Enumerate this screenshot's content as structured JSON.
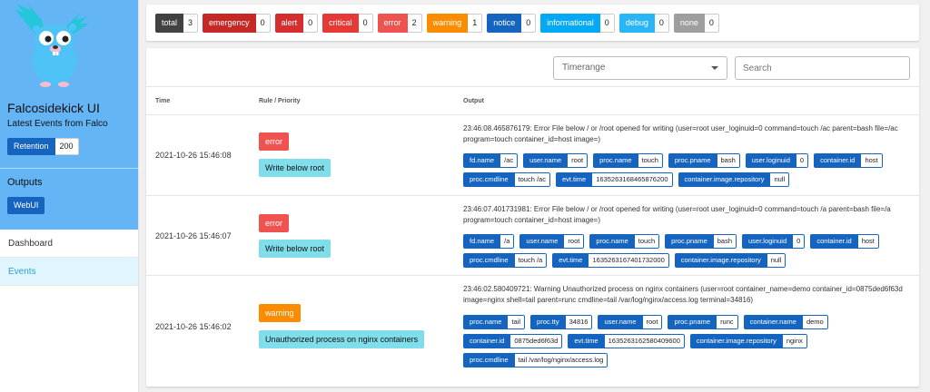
{
  "sidebar": {
    "title": "Falcosidekick UI",
    "subtitle": "Latest Events from Falco",
    "retention_label": "Retention",
    "retention_value": "200",
    "outputs_title": "Outputs",
    "outputs_button": "WebUI",
    "nav": [
      {
        "label": "Dashboard",
        "active": false
      },
      {
        "label": "Events",
        "active": true
      }
    ],
    "colors": {
      "top_bg": "#64b5f6",
      "active_bg": "#e1f5fe"
    }
  },
  "filters": [
    {
      "name": "total",
      "count": "3",
      "color": "#424242"
    },
    {
      "name": "emergency",
      "count": "0",
      "color": "#c62828"
    },
    {
      "name": "alert",
      "count": "0",
      "color": "#d32f2f"
    },
    {
      "name": "critical",
      "count": "0",
      "color": "#e53935"
    },
    {
      "name": "error",
      "count": "2",
      "color": "#ef5350"
    },
    {
      "name": "warning",
      "count": "1",
      "color": "#fb8c00"
    },
    {
      "name": "notice",
      "count": "0",
      "color": "#1565c0"
    },
    {
      "name": "informational",
      "count": "0",
      "color": "#03a9f4"
    },
    {
      "name": "debug",
      "count": "0",
      "color": "#29b6f6"
    },
    {
      "name": "none",
      "count": "0",
      "color": "#9e9e9e"
    }
  ],
  "toolbar": {
    "timerange_placeholder": "Timerange",
    "search_placeholder": "Search"
  },
  "table": {
    "headers": {
      "time": "Time",
      "rule": "Rule / Priority",
      "output": "Output"
    },
    "rows": [
      {
        "time": "2021-10-26 15:46:08",
        "priority": "error",
        "priority_color": "#ef5350",
        "rule": "Write below root",
        "output": "23:46:08.465876179: Error File below / or /root opened for writing (user=root user_loginuid=0 command=touch /ac parent=bash file=/ac program=touch container_id=host image=)",
        "fields": [
          {
            "k": "fd.name",
            "v": "/ac"
          },
          {
            "k": "user.name",
            "v": "root"
          },
          {
            "k": "proc.name",
            "v": "touch"
          },
          {
            "k": "proc.pname",
            "v": "bash"
          },
          {
            "k": "user.loginuid",
            "v": "0"
          },
          {
            "k": "container.id",
            "v": "host"
          },
          {
            "k": "proc.cmdline",
            "v": "touch /ac"
          },
          {
            "k": "evt.time",
            "v": "1635263168465876200"
          },
          {
            "k": "container.image.repository",
            "v": "null"
          }
        ]
      },
      {
        "time": "2021-10-26 15:46:07",
        "priority": "error",
        "priority_color": "#ef5350",
        "rule": "Write below root",
        "output": "23:46:07.401731981: Error File below / or /root opened for writing (user=root user_loginuid=0 command=touch /a parent=bash file=/a program=touch container_id=host image=)",
        "fields": [
          {
            "k": "fd.name",
            "v": "/a"
          },
          {
            "k": "user.name",
            "v": "root"
          },
          {
            "k": "proc.name",
            "v": "touch"
          },
          {
            "k": "proc.pname",
            "v": "bash"
          },
          {
            "k": "user.loginuid",
            "v": "0"
          },
          {
            "k": "container.id",
            "v": "host"
          },
          {
            "k": "proc.cmdline",
            "v": "touch /a"
          },
          {
            "k": "evt.time",
            "v": "1635263167401732000"
          },
          {
            "k": "container.image.repository",
            "v": "null"
          }
        ]
      },
      {
        "time": "2021-10-26 15:46:02",
        "priority": "warning",
        "priority_color": "#fb8c00",
        "rule": "Unauthorized process on nginx containers",
        "output": "23:46:02.580409721: Warning Unauthorized process on nginx containers (user=root container_name=demo container_id=0875ded6f63d image=nginx shell=tail parent=runc cmdline=tail /var/log/nginx/access.log terminal=34816)",
        "fields": [
          {
            "k": "proc.name",
            "v": "tail"
          },
          {
            "k": "proc.tty",
            "v": "34816"
          },
          {
            "k": "user.name",
            "v": "root"
          },
          {
            "k": "proc.pname",
            "v": "runc"
          },
          {
            "k": "container.name",
            "v": "demo"
          },
          {
            "k": "container.id",
            "v": "0875ded6f63d"
          },
          {
            "k": "evt.time",
            "v": "1635263162580409600"
          },
          {
            "k": "container.image.repository",
            "v": "nginx"
          },
          {
            "k": "proc.cmdline",
            "v": "tail /var/log/nginx/access.log"
          }
        ]
      }
    ]
  }
}
